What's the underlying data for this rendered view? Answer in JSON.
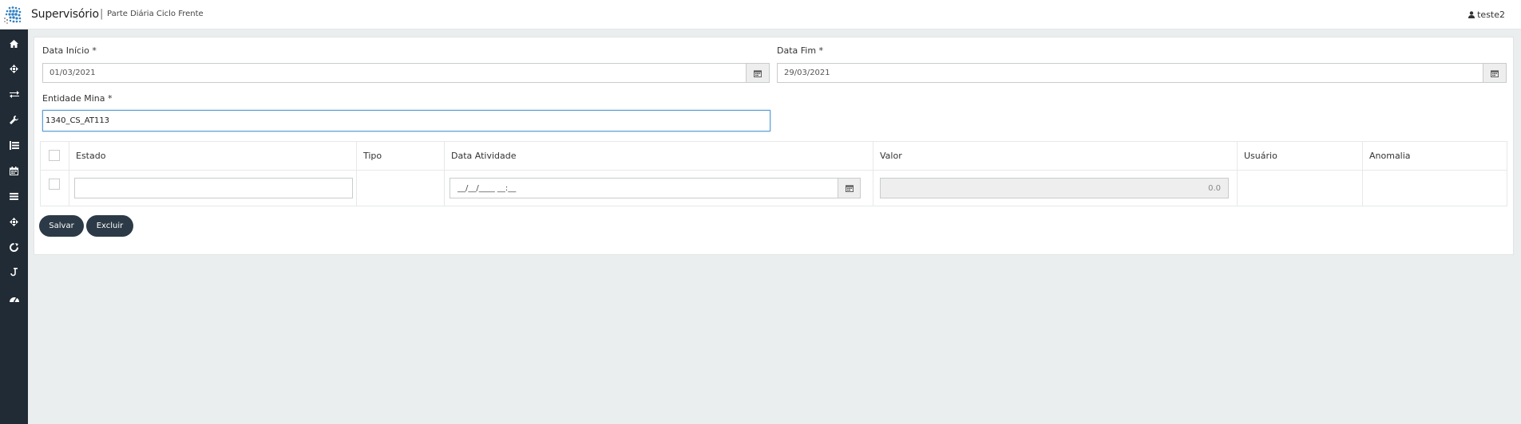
{
  "header": {
    "app_title": "Supervisório",
    "separator": "|",
    "page_subtitle": "Parte Diária Ciclo Frente",
    "user": "teste2"
  },
  "sidebar": {
    "items": [
      {
        "icon": "home-icon"
      },
      {
        "icon": "move-icon"
      },
      {
        "icon": "exchange-icon"
      },
      {
        "icon": "wrench-icon"
      },
      {
        "icon": "list-icon"
      },
      {
        "icon": "calendar-icon"
      },
      {
        "icon": "menu-icon"
      },
      {
        "icon": "move-icon"
      },
      {
        "icon": "refresh-icon"
      },
      {
        "icon": "hook-icon"
      },
      {
        "icon": "dashboard-icon"
      }
    ]
  },
  "form": {
    "data_inicio": {
      "label": "Data Início *",
      "value": "01/03/2021"
    },
    "data_fim": {
      "label": "Data Fim *",
      "value": "29/03/2021"
    },
    "entidade_mina": {
      "label": "Entidade Mina *",
      "value": "1340_CS_AT113"
    }
  },
  "table": {
    "columns": [
      "Estado",
      "Tipo",
      "Data Atividade",
      "Valor",
      "Usuário",
      "Anomalia"
    ],
    "row": {
      "estado": "",
      "data_atividade_placeholder": "__/__/____ __:__",
      "valor": "0.0"
    }
  },
  "actions": {
    "save_label": "Salvar",
    "delete_label": "Excluir"
  },
  "colors": {
    "sidebar": "#212b35",
    "button": "#2b3a46",
    "focus_border": "#5a9bd4"
  }
}
